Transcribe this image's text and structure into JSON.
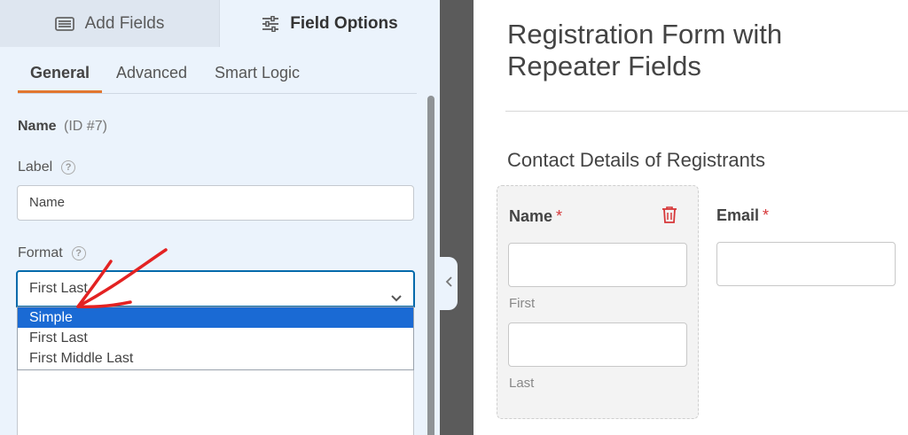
{
  "builder": {
    "top_tabs": {
      "add_fields": "Add Fields",
      "field_options": "Field Options"
    },
    "sub_tabs": {
      "general": "General",
      "advanced": "Advanced",
      "smart_logic": "Smart Logic"
    },
    "field": {
      "name": "Name",
      "id_text": "(ID #7)"
    },
    "label_option": {
      "label": "Label",
      "value": "Name"
    },
    "format_option": {
      "label": "Format",
      "selected_value": "First Last",
      "options": [
        "Simple",
        "First Last",
        "First Middle Last"
      ],
      "highlighted_option": "Simple"
    }
  },
  "preview": {
    "form_title": "Registration Form with Repeater Fields",
    "section_title": "Contact Details of Registrants",
    "name_field": {
      "label": "Name",
      "required_mark": "*",
      "sublabel_first": "First",
      "sublabel_last": "Last"
    },
    "email_field": {
      "label": "Email",
      "required_mark": "*"
    }
  },
  "colors": {
    "accent_orange": "#e27730",
    "select_border": "#036aab",
    "highlight_blue": "#1a6ad4",
    "required_red": "#d63638",
    "annotation_red": "#e32222"
  },
  "icons": {
    "add_fields_tab": "list-icon",
    "field_options_tab": "sliders-icon",
    "help": "question-circle-icon",
    "select": "chevron-down-icon",
    "collapse": "chevron-left-icon",
    "repeater_delete": "trash-icon"
  }
}
